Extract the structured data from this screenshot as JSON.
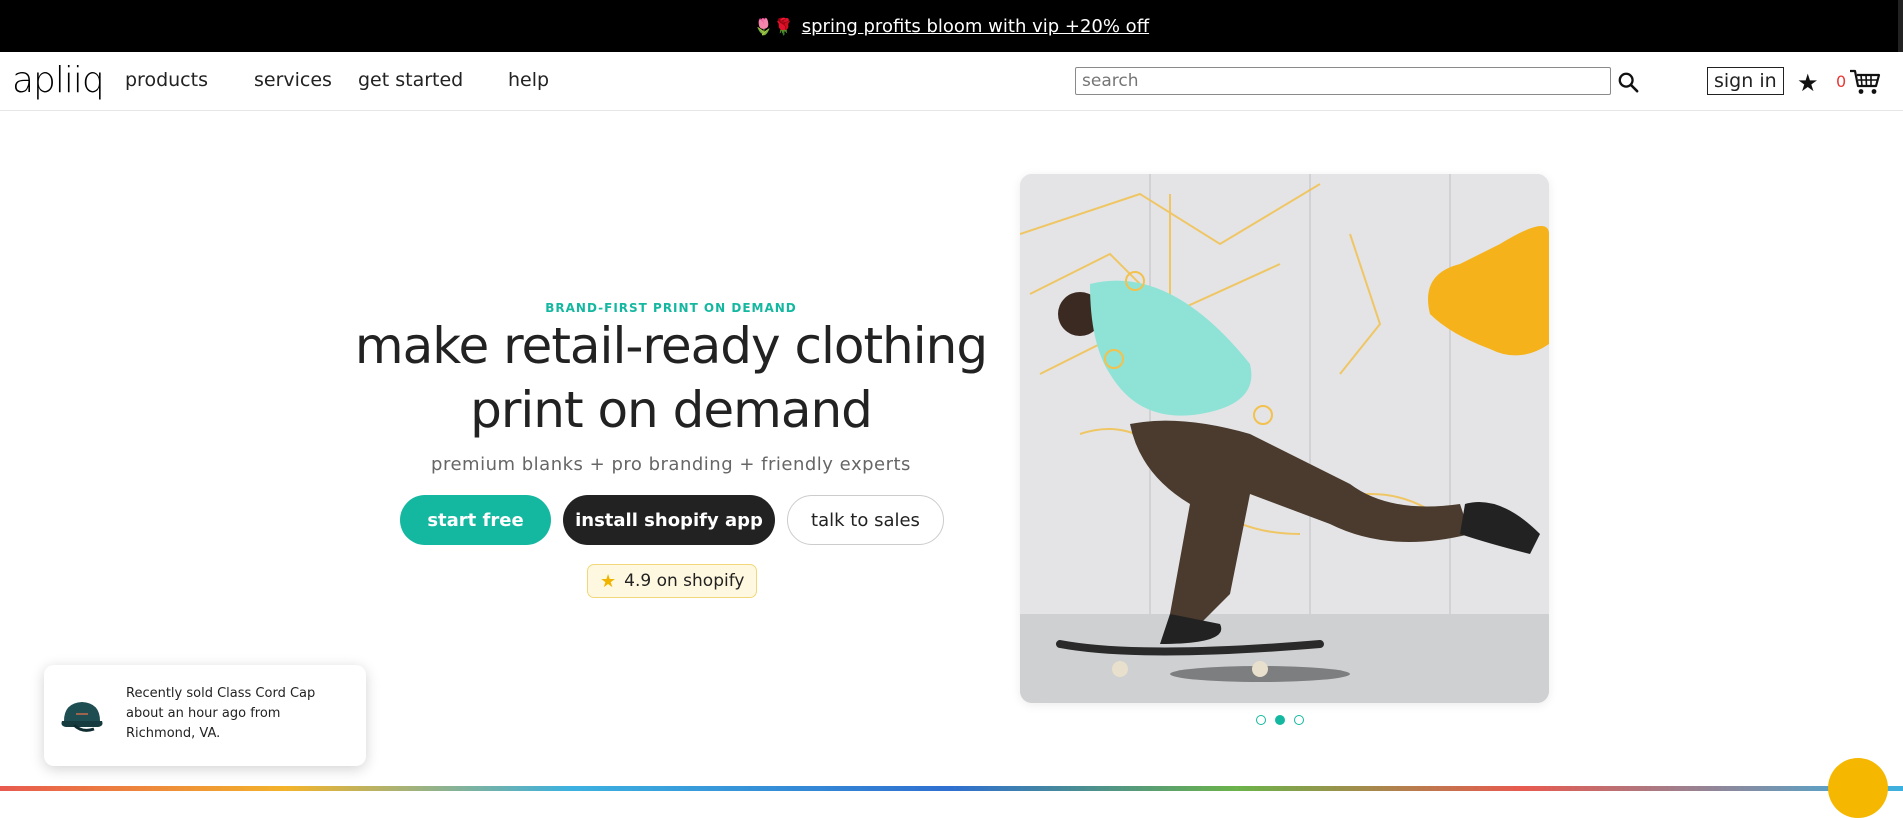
{
  "promo": {
    "emoji": "🌷🌹",
    "link_text": "spring profits bloom with vip +20% off"
  },
  "header": {
    "logo": "apliiq",
    "nav": [
      "products",
      "services",
      "get started",
      "help"
    ],
    "search_placeholder": "search",
    "signin_label": "sign in",
    "cart_count": "0"
  },
  "hero": {
    "eyebrow": "BRAND-FIRST PRINT ON DEMAND",
    "headline_line1": "make retail-ready clothing",
    "headline_line2": "print on demand",
    "subline": "premium blanks + pro branding + friendly experts",
    "buttons": {
      "start": "start free",
      "shopify": "install shopify app",
      "sales": "talk to sales"
    },
    "rating": "4.9 on shopify",
    "carousel": {
      "slides": 3,
      "active": 2
    }
  },
  "popup": {
    "message": "Recently sold Class Cord Cap about an hour ago from Richmond, VA."
  },
  "colors": {
    "accent": "#14b8a0",
    "dark": "#222222",
    "promo_bg": "#000000",
    "rating_bg": "#fff8e0",
    "cart_count": "#e53935"
  }
}
